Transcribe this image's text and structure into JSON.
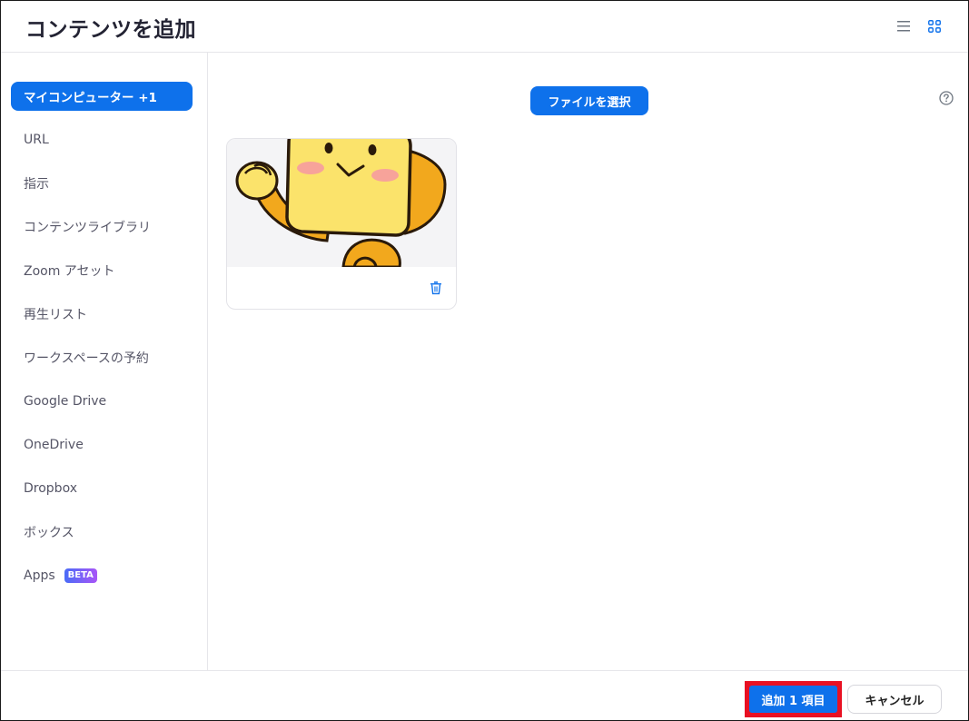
{
  "header": {
    "title": "コンテンツを追加",
    "list_view_icon": "list-icon",
    "grid_view_icon": "grid-icon"
  },
  "sidebar": {
    "items": [
      {
        "label": "マイコンピューター +1",
        "active": true
      },
      {
        "label": "URL"
      },
      {
        "label": "指示"
      },
      {
        "label": "コンテンツライブラリ"
      },
      {
        "label": "Zoom アセット"
      },
      {
        "label": "再生リスト"
      },
      {
        "label": "ワークスペースの予約"
      },
      {
        "label": "Google Drive"
      },
      {
        "label": "OneDrive"
      },
      {
        "label": "Dropbox"
      },
      {
        "label": "ボックス"
      },
      {
        "label": "Apps",
        "badge": "BETA"
      }
    ]
  },
  "main": {
    "choose_file_label": "ファイルを選択",
    "help_icon": "question-circle-icon",
    "card": {
      "thumbnail": "yellow-mascot-image",
      "delete_icon": "trash-icon"
    }
  },
  "footer": {
    "add_label": "追加 1 項目",
    "cancel_label": "キャンセル"
  },
  "colors": {
    "accent": "#0e71eb",
    "highlight_frame": "#e81123",
    "mascot_yellow": "#fbe36b",
    "mascot_orange": "#f2a81d"
  }
}
